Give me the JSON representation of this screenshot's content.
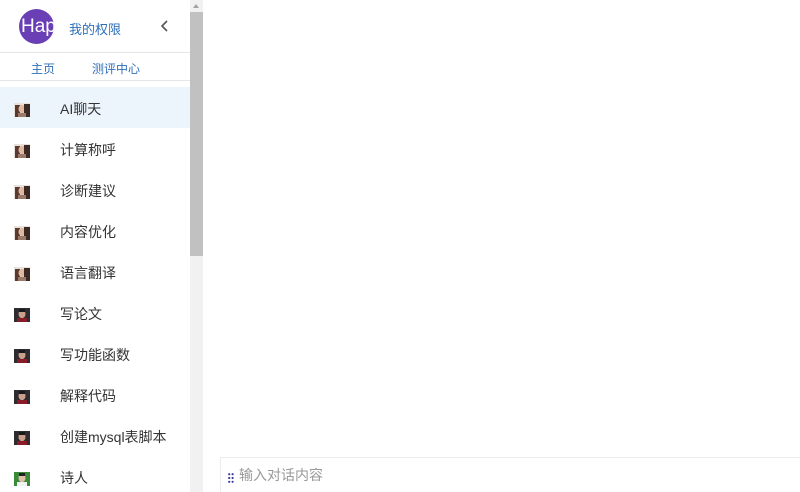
{
  "header": {
    "avatar_text": "Hap",
    "permissions_link": "我的权限"
  },
  "nav": {
    "home": "主页",
    "evaluation": "测评中心"
  },
  "menu": {
    "items": [
      {
        "label": "AI聊天",
        "thumb": "person-a",
        "active": true
      },
      {
        "label": "计算称呼",
        "thumb": "person-a"
      },
      {
        "label": "诊断建议",
        "thumb": "person-a"
      },
      {
        "label": "内容优化",
        "thumb": "person-a"
      },
      {
        "label": "语言翻译",
        "thumb": "person-a"
      },
      {
        "label": "写论文",
        "thumb": "person-b"
      },
      {
        "label": "写功能函数",
        "thumb": "person-b"
      },
      {
        "label": "解释代码",
        "thumb": "person-b"
      },
      {
        "label": "创建mysql表脚本",
        "thumb": "person-b"
      },
      {
        "label": "诗人",
        "thumb": "person-c"
      }
    ]
  },
  "chat": {
    "input_placeholder": "输入对话内容",
    "input_value": ""
  },
  "colors": {
    "accent_link": "#2f6fba",
    "avatar_bg": "#6a3fb5",
    "active_item_bg": "#ecf4fc"
  }
}
